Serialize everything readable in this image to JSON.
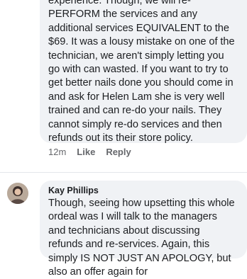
{
  "comment1": {
    "text": "experience. Though, we will re-PERFORM the services and any additional services EQUIVALENT to the $69. It was a lousy mistake on one of the technician, we aren't simply letting you go with can wasted. If you want to try to get better nails done you should come in and ask for Helen Lam she is very well trained and can re-do your nails. They cannot simply re-do services and then refunds out its their store policy.",
    "time": "12m",
    "like_label": "Like",
    "reply_label": "Reply"
  },
  "comment2": {
    "author": "Kay Phillips",
    "avatar_icon": "person-avatar-icon",
    "text": "Though, seeing how upsetting this whole ordeal was I will talk to the managers and technicians about discussing refunds and re-services. Again, this simply IS NOT JUST AN APOLOGY, but also an offer again for"
  }
}
